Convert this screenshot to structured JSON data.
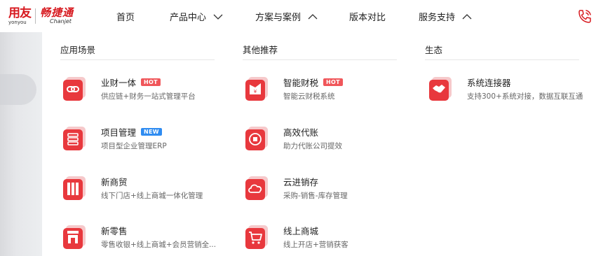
{
  "logo": {
    "brand_cn": "用友",
    "brand_en": "yonyou",
    "product_cn": "畅捷通",
    "product_en": "Chanjet"
  },
  "nav": {
    "items": [
      {
        "label": "首页"
      },
      {
        "label": "产品中心"
      },
      {
        "label": "方案与案例"
      },
      {
        "label": "版本对比"
      },
      {
        "label": "服务支持"
      }
    ]
  },
  "columns": [
    {
      "heading": "应用场景"
    },
    {
      "heading": "其他推荐"
    },
    {
      "heading": "生态"
    }
  ],
  "scenes": [
    {
      "title": "业财一体",
      "badge": "HOT",
      "desc": "供应链+财务一站式管理平台"
    },
    {
      "title": "项目管理",
      "badge": "NEW",
      "desc": "项目型企业管理ERP"
    },
    {
      "title": "新商贸",
      "badge": "",
      "desc": "线下门店+线上商城一体化管理"
    },
    {
      "title": "新零售",
      "badge": "",
      "desc": "零售收银+线上商城+会员营销全..."
    }
  ],
  "recommend": [
    {
      "title": "智能财税",
      "badge": "HOT",
      "desc": "智能云财税系统"
    },
    {
      "title": "高效代账",
      "badge": "",
      "desc": "助力代账公司提效"
    },
    {
      "title": "云进销存",
      "badge": "",
      "desc": "采购-销售-库存管理"
    },
    {
      "title": "线上商城",
      "badge": "",
      "desc": "线上开店+营销获客"
    }
  ],
  "ecosystem": [
    {
      "title": "系统连接器",
      "badge": "",
      "desc": "支持300+系统对接，数据互联互通"
    }
  ],
  "icons": {
    "scene_0": "link-chain-icon",
    "scene_1": "project-list-icon",
    "scene_2": "store-bars-icon",
    "scene_3": "retail-shop-icon",
    "rec_0": "finance-tax-icon",
    "rec_1": "bookkeeping-icon",
    "rec_2": "cloud-inventory-icon",
    "rec_3": "shopping-cart-icon",
    "eco_0": "handshake-icon"
  },
  "colors": {
    "brand_red": "#d7191f",
    "icon_red": "#e8383d",
    "hot_badge": "#f0565a",
    "new_badge": "#2f8cf1"
  }
}
